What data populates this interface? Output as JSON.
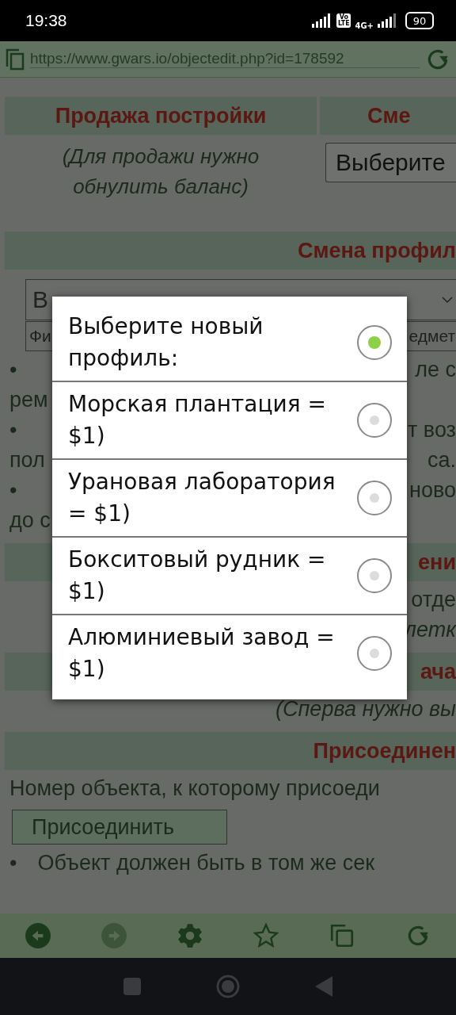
{
  "status_bar": {
    "time": "19:38",
    "volte": "Vo LTE",
    "network": "4G+",
    "battery": "90"
  },
  "address_bar": {
    "url": "https://www.gwars.io/objectedit.php?id=178592"
  },
  "page": [
    {
      "kind": "header_pair",
      "left": "Продажа постройки",
      "right": "Сме"
    },
    {
      "kind": "note_select",
      "note": "(Для продажи нужно обнулить баланс)",
      "select": "Выберите"
    },
    {
      "kind": "header",
      "text": "Смена профил"
    },
    {
      "kind": "select",
      "left": "В"
    },
    {
      "kind": "field",
      "left": "Фи",
      "right": "едмет"
    },
    {
      "kind": "line",
      "bullet": "•",
      "right": "ле с"
    },
    {
      "kind": "line",
      "left": "рем"
    },
    {
      "kind": "line",
      "bullet": "•",
      "right": "т воз"
    },
    {
      "kind": "line",
      "left": "пол",
      "right": "са."
    },
    {
      "kind": "line",
      "bullet": "•",
      "right": "ново"
    },
    {
      "kind": "line",
      "left": "до с"
    },
    {
      "kind": "header",
      "text": "ени"
    },
    {
      "kind": "line",
      "right": "отде"
    },
    {
      "kind": "line",
      "right": "летк",
      "italic": true
    },
    {
      "kind": "header",
      "text": "ача"
    },
    {
      "kind": "line",
      "right": "(Сперва нужно вы",
      "italic": true
    },
    {
      "kind": "header",
      "text": "Присоединен"
    },
    {
      "kind": "line",
      "left": "Номер объекта, к которому присоеди"
    },
    {
      "kind": "button",
      "label": "Присоединить"
    },
    {
      "kind": "line",
      "bullet": "•",
      "left": "Объект должен быть в том же сек"
    }
  ],
  "dialog": {
    "options": [
      {
        "label": "Выберите новый профиль:",
        "selected": true
      },
      {
        "label": "Морская плантация = $1)",
        "selected": false
      },
      {
        "label": "Урановая лаборатория = $1)",
        "selected": false
      },
      {
        "label": "Бокситовый рудник = $1)",
        "selected": false
      },
      {
        "label": "Алюминиевый завод = $1)",
        "selected": false
      }
    ]
  },
  "toolbar": [
    {
      "kind": "back",
      "disabled": false
    },
    {
      "kind": "forward",
      "disabled": true
    },
    {
      "kind": "settings",
      "disabled": false
    },
    {
      "kind": "star",
      "disabled": false
    },
    {
      "kind": "tabs",
      "disabled": false
    },
    {
      "kind": "reload",
      "disabled": false
    }
  ]
}
